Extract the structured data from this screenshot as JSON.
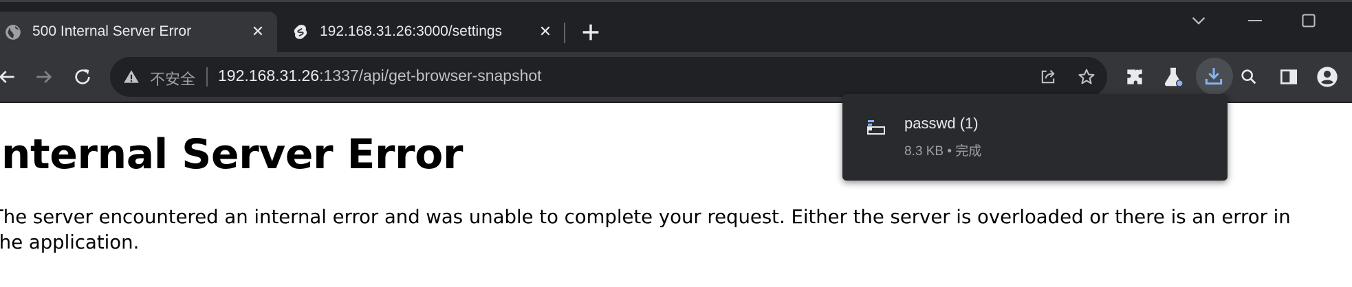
{
  "tabs": [
    {
      "title": "500 Internal Server Error",
      "favicon": "globe-icon",
      "active": true
    },
    {
      "title": "192.168.31.26:3000/settings",
      "favicon": "svelte-icon",
      "active": false
    }
  ],
  "toolbar": {
    "security_label": "不安全",
    "url_host": "192.168.31.26",
    "url_rest": ":1337/api/get-browser-snapshot"
  },
  "page": {
    "title": "Internal Server Error",
    "body": "The server encountered an internal error and was unable to complete your request. Either the server is overloaded or there is an error in the application."
  },
  "download": {
    "file_name": "passwd (1)",
    "status": "8.3 KB • 完成"
  },
  "colors": {
    "tabstrip_bg": "#202124",
    "toolbar_bg": "#35363a",
    "accent": "#8ab4f8",
    "bubble_bg": "#292a2d"
  }
}
